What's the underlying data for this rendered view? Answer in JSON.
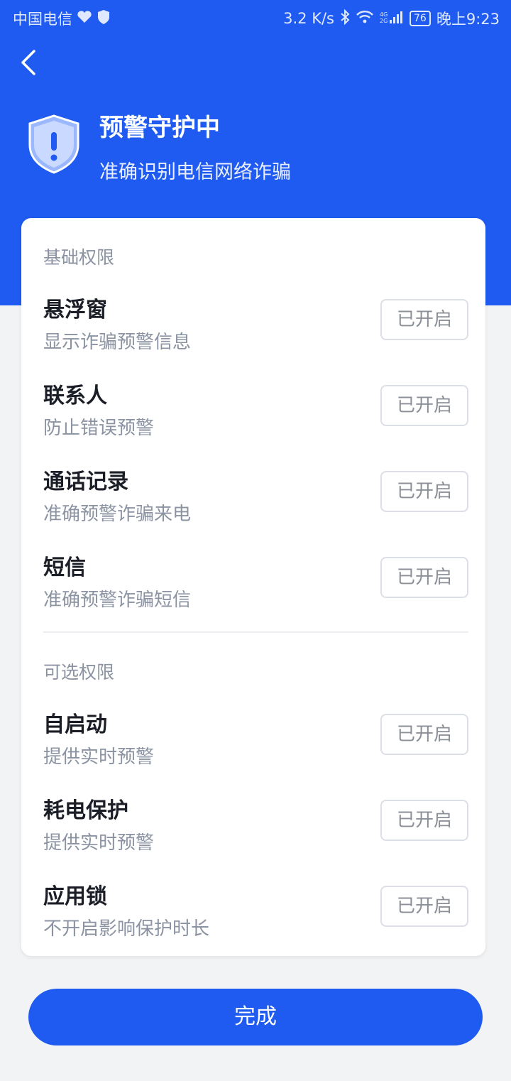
{
  "status_bar": {
    "carrier": "中国电信",
    "speed": "3.2 K/s",
    "network": "4G 2G",
    "battery": "76",
    "time": "晚上9:23"
  },
  "header": {
    "title": "预警守护中",
    "subtitle": "准确识别电信网络诈骗"
  },
  "basic_section": {
    "label": "基础权限",
    "items": [
      {
        "title": "悬浮窗",
        "desc": "显示诈骗预警信息",
        "status": "已开启"
      },
      {
        "title": "联系人",
        "desc": "防止错误预警",
        "status": "已开启"
      },
      {
        "title": "通话记录",
        "desc": "准确预警诈骗来电",
        "status": "已开启"
      },
      {
        "title": "短信",
        "desc": "准确预警诈骗短信",
        "status": "已开启"
      }
    ]
  },
  "optional_section": {
    "label": "可选权限",
    "items": [
      {
        "title": "自启动",
        "desc": "提供实时预警",
        "status": "已开启"
      },
      {
        "title": "耗电保护",
        "desc": "提供实时预警",
        "status": "已开启"
      },
      {
        "title": "应用锁",
        "desc": "不开启影响保护时长",
        "status": "已开启"
      }
    ]
  },
  "done_label": "完成",
  "colors": {
    "primary": "#1f5bf0",
    "background": "#f2f3f5",
    "muted_text": "#8b93a2"
  }
}
